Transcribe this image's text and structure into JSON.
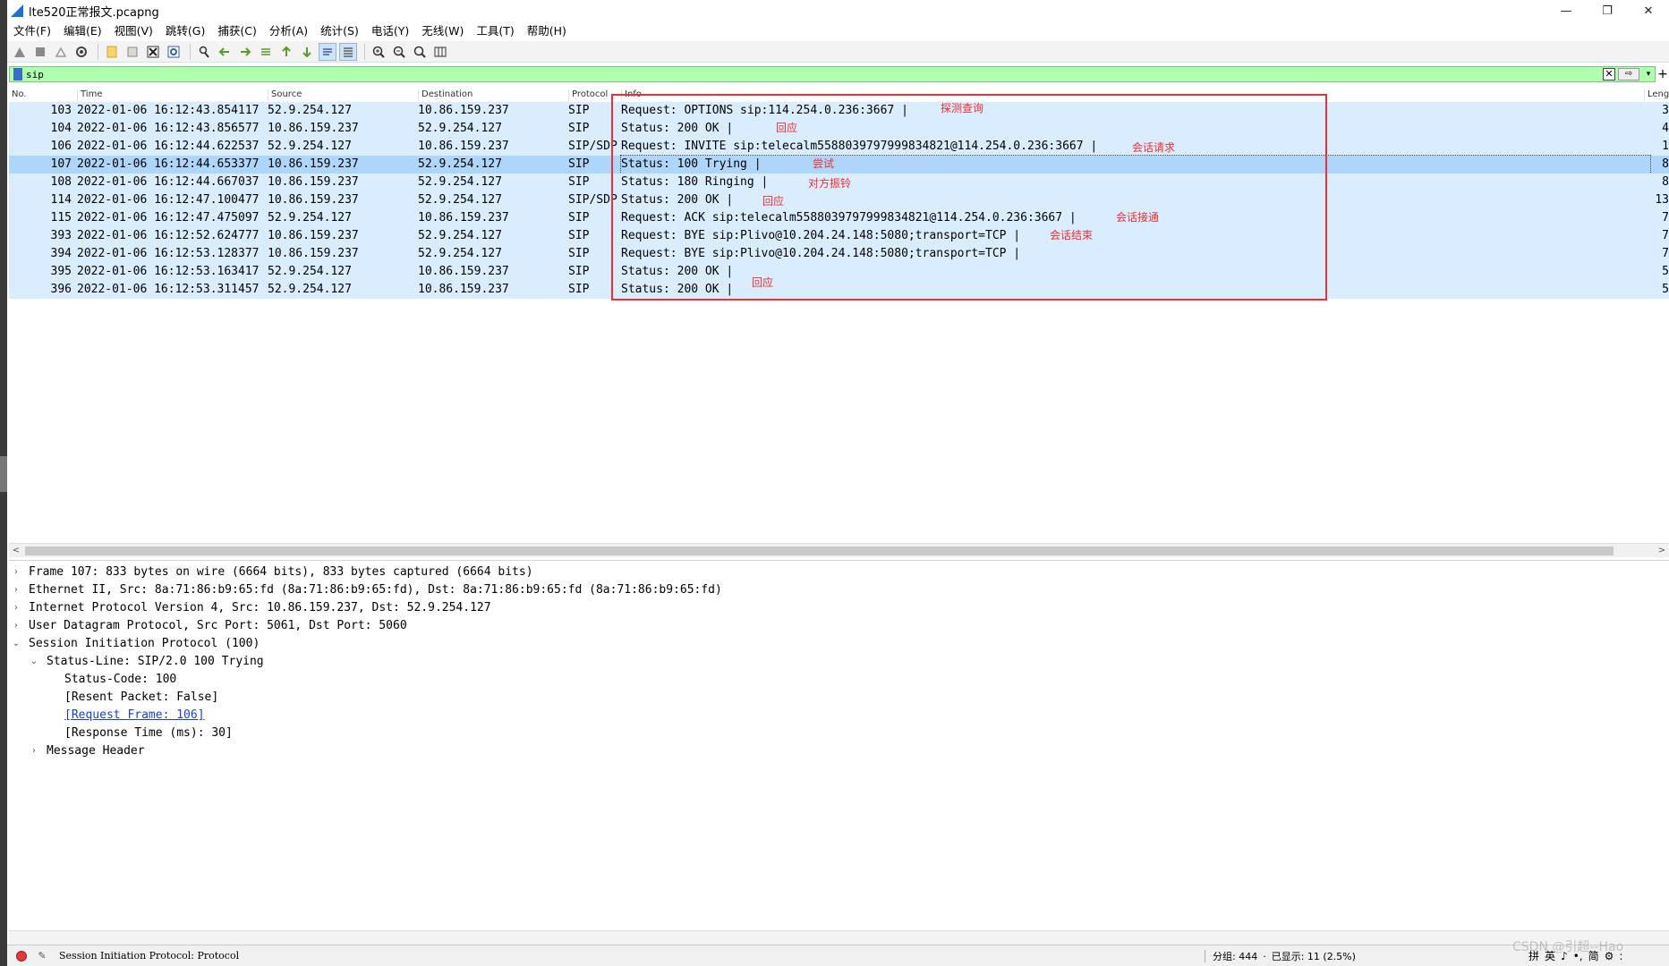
{
  "window": {
    "title": "lte520正常报文.pcapng",
    "minimize": "—",
    "maximize": "❐",
    "close": "✕"
  },
  "menu": [
    "文件(F)",
    "编辑(E)",
    "视图(V)",
    "跳转(G)",
    "捕获(C)",
    "分析(A)",
    "统计(S)",
    "电话(Y)",
    "无线(W)",
    "工具(T)",
    "帮助(H)"
  ],
  "toolbar_icons": [
    "shark-fin-start-icon",
    "stop-capture-icon",
    "restart-capture-icon",
    "capture-options-icon",
    "open-file-icon",
    "save-file-icon",
    "close-file-icon",
    "reload-file-icon",
    "find-packet-icon",
    "go-back-icon",
    "go-forward-icon",
    "go-to-packet-icon",
    "go-first-icon",
    "go-last-icon",
    "auto-scroll-icon",
    "colorize-icon",
    "zoom-in-icon",
    "zoom-out-icon",
    "zoom-normal-icon",
    "resize-columns-icon"
  ],
  "filter": {
    "value": "sip",
    "clear": "✕",
    "apply": "⇨",
    "dropdown": "▾",
    "add": "+"
  },
  "columns": {
    "no": "No.",
    "time": "Time",
    "source": "Source",
    "destination": "Destination",
    "protocol": "Protocol",
    "info": "Info",
    "length": "Leng"
  },
  "packets": [
    {
      "no": "103",
      "time": "2022-01-06 16:12:43.854117",
      "src": "52.9.254.127",
      "dst": "10.86.159.237",
      "proto": "SIP",
      "info": "Request: OPTIONS sip:114.254.0.236:3667 |",
      "len": "3"
    },
    {
      "no": "104",
      "time": "2022-01-06 16:12:43.856577",
      "src": "10.86.159.237",
      "dst": "52.9.254.127",
      "proto": "SIP",
      "info": "Status: 200 OK |",
      "len": "4"
    },
    {
      "no": "106",
      "time": "2022-01-06 16:12:44.622537",
      "src": "52.9.254.127",
      "dst": "10.86.159.237",
      "proto": "SIP/SDP",
      "info": "Request: INVITE sip:telecalm5588039797999834821@114.254.0.236:3667 |",
      "len": "1"
    },
    {
      "no": "107",
      "time": "2022-01-06 16:12:44.653377",
      "src": "10.86.159.237",
      "dst": "52.9.254.127",
      "proto": "SIP",
      "info": "Status: 100 Trying |",
      "len": "8"
    },
    {
      "no": "108",
      "time": "2022-01-06 16:12:44.667037",
      "src": "10.86.159.237",
      "dst": "52.9.254.127",
      "proto": "SIP",
      "info": "Status: 180 Ringing |",
      "len": "8"
    },
    {
      "no": "114",
      "time": "2022-01-06 16:12:47.100477",
      "src": "10.86.159.237",
      "dst": "52.9.254.127",
      "proto": "SIP/SDP",
      "info": "Status: 200 OK |",
      "len": "13"
    },
    {
      "no": "115",
      "time": "2022-01-06 16:12:47.475097",
      "src": "52.9.254.127",
      "dst": "10.86.159.237",
      "proto": "SIP",
      "info": "Request: ACK sip:telecalm5588039797999834821@114.254.0.236:3667 |",
      "len": "7"
    },
    {
      "no": "393",
      "time": "2022-01-06 16:12:52.624777",
      "src": "10.86.159.237",
      "dst": "52.9.254.127",
      "proto": "SIP",
      "info": "Request: BYE sip:Plivo@10.204.24.148:5080;transport=TCP |",
      "len": "7"
    },
    {
      "no": "394",
      "time": "2022-01-06 16:12:53.128377",
      "src": "10.86.159.237",
      "dst": "52.9.254.127",
      "proto": "SIP",
      "info": "Request: BYE sip:Plivo@10.204.24.148:5080;transport=TCP |",
      "len": "7"
    },
    {
      "no": "395",
      "time": "2022-01-06 16:12:53.163417",
      "src": "52.9.254.127",
      "dst": "10.86.159.237",
      "proto": "SIP",
      "info": "Status: 200 OK |",
      "len": "5"
    },
    {
      "no": "396",
      "time": "2022-01-06 16:12:53.311457",
      "src": "52.9.254.127",
      "dst": "10.86.159.237",
      "proto": "SIP",
      "info": "Status: 200 OK |",
      "len": "5"
    }
  ],
  "selected_packet": "107",
  "annotations": {
    "probe_query": "探测查询",
    "reply_1": "回应",
    "session_request": "会话请求",
    "trying": "尝试",
    "ringing": "对方振铃",
    "reply_2": "回应",
    "connected": "会话接通",
    "session_end": "会话结束",
    "reply_3": "回应",
    "accent_color": "#ef2f2f"
  },
  "details": {
    "frame": "Frame 107: 833 bytes on wire (6664 bits), 833 bytes captured (6664 bits)",
    "ethernet": "Ethernet II, Src: 8a:71:86:b9:65:fd (8a:71:86:b9:65:fd), Dst: 8a:71:86:b9:65:fd (8a:71:86:b9:65:fd)",
    "ip": "Internet Protocol Version 4, Src: 10.86.159.237, Dst: 52.9.254.127",
    "udp": "User Datagram Protocol, Src Port: 5061, Dst Port: 5060",
    "sip": "Session Initiation Protocol (100)",
    "status_line": "Status-Line: SIP/2.0 100 Trying",
    "status_code": "Status-Code: 100",
    "resent": "[Resent Packet: False]",
    "request_frame": "[Request Frame: 106]",
    "response_time": "[Response Time (ms): 30]",
    "message_header": "Message Header"
  },
  "status": {
    "protocol_text": "Session Initiation Protocol: Protocol",
    "packets": "分组: 444",
    "displayed": "已显示: 11 (2.5%)",
    "ime": [
      "拼",
      "英",
      "♪",
      "•,",
      "简",
      "⚙",
      ":"
    ]
  },
  "watermark": "CSDN @引超--Hao"
}
